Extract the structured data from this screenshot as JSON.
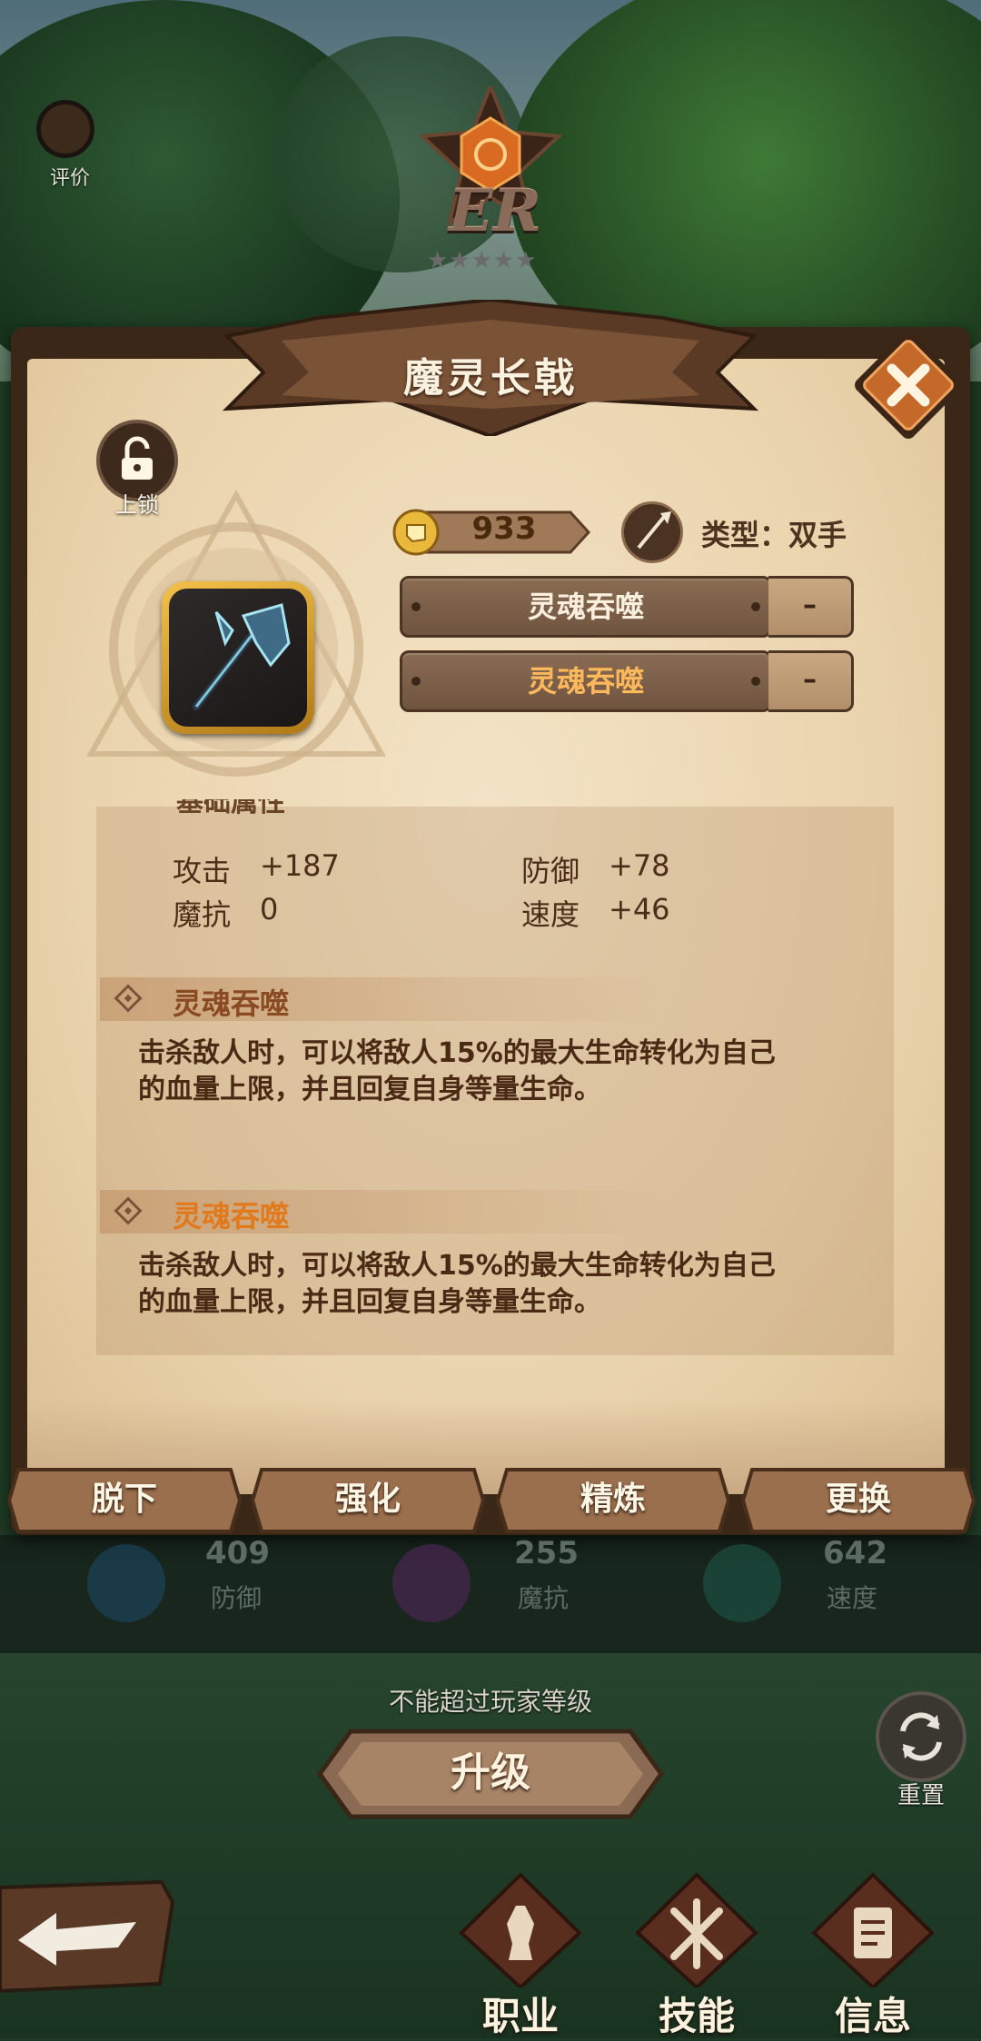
{
  "hud": {
    "evaluate_label": "评价",
    "rank_text": "ER",
    "rank_stars": "★★★★★"
  },
  "item": {
    "name": "魔灵长戟",
    "lock_label": "上锁",
    "power": "933",
    "type_text": "类型：双手",
    "rune_slots": [
      {
        "name": "灵魂吞噬",
        "value": "–",
        "color": "#fbeedd"
      },
      {
        "name": "灵魂吞噬",
        "value": "–",
        "color": "#ffb85c"
      }
    ]
  },
  "base_stats": {
    "section_title": "基础属性",
    "rows": [
      {
        "label": "攻击",
        "value": "+187"
      },
      {
        "label": "防御",
        "value": "+78"
      },
      {
        "label": "魔抗",
        "value": "0"
      },
      {
        "label": "速度",
        "value": "+46"
      }
    ]
  },
  "skills": [
    {
      "name": "灵魂吞噬",
      "color": "#8a4a22",
      "desc_line1": "击杀敌人时，可以将敌人15%的最大生命转化为自己",
      "desc_line2": "的血量上限，并且回复自身等量生命。"
    },
    {
      "name": "灵魂吞噬",
      "color": "#e07a1c",
      "desc_line1": "击杀敌人时，可以将敌人15%的最大生命转化为自己",
      "desc_line2": "的血量上限，并且回复自身等量生命。"
    }
  ],
  "actions": {
    "unequip": "脱下",
    "enhance": "强化",
    "refine": "精炼",
    "replace": "更换"
  },
  "hero_stats": [
    {
      "value": "409",
      "label": "防御"
    },
    {
      "value": "255",
      "label": "魔抗"
    },
    {
      "value": "642",
      "label": "速度"
    }
  ],
  "footer": {
    "limit_text": "不能超过玩家等级",
    "upgrade_label": "升级",
    "reset_label": "重置",
    "nav": {
      "class": "职业",
      "skill": "技能",
      "info": "信息"
    }
  },
  "colors": {
    "paper": "#ead4ae",
    "frame": "#3a2717",
    "accent_orange": "#e07a1c",
    "gold": "#f2c14a"
  }
}
